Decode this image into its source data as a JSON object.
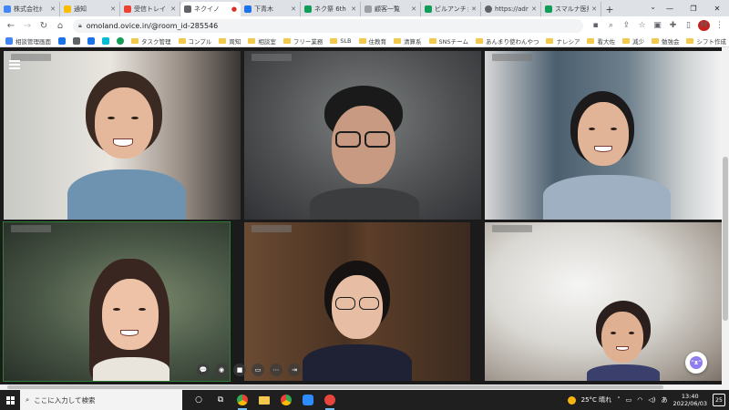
{
  "browser": {
    "tabs": [
      {
        "label": "株式会社ﾎ",
        "color": "#4285f4",
        "active": false
      },
      {
        "label": "通知",
        "color": "#fbbc04",
        "active": false
      },
      {
        "label": "受信トレイ",
        "color": "#ea4335",
        "active": false
      },
      {
        "label": "ネクイノ",
        "color": "#5f6368",
        "active": true
      },
      {
        "label": "下青木",
        "color": "#1a73e8",
        "active": false
      },
      {
        "label": "ネク祭 6th",
        "color": "#0f9d58",
        "active": false
      },
      {
        "label": "顧客一覧",
        "color": "#9aa0a6",
        "active": false
      },
      {
        "label": "ビルアンチョ",
        "color": "#0f9d58",
        "active": false
      },
      {
        "label": "https://adr",
        "color": "#5f6368",
        "active": false
      },
      {
        "label": "スマルナ医療",
        "color": "#0f9d58",
        "active": false
      }
    ],
    "new_tab": "+",
    "url": "omoland.ovice.in/@room_id-285546",
    "profile_initial": "M",
    "window_controls": {
      "minimize": "—",
      "restore": "❐",
      "close": "✕"
    }
  },
  "bookmarks": [
    {
      "label": "相談管理画面",
      "type": "ico",
      "color": "#4285f4"
    },
    {
      "label": "",
      "type": "ico",
      "color": "#1a73e8"
    },
    {
      "label": "",
      "type": "ico",
      "color": "#5f6368"
    },
    {
      "label": "",
      "type": "ico",
      "color": "#1a73e8"
    },
    {
      "label": "",
      "type": "ico",
      "color": "#00bcd4"
    },
    {
      "label": "",
      "type": "ico",
      "color": "#0f9d58"
    },
    {
      "label": "タスク管理",
      "type": "folder"
    },
    {
      "label": "コンプル",
      "type": "folder"
    },
    {
      "label": "周知",
      "type": "folder"
    },
    {
      "label": "相談室",
      "type": "folder"
    },
    {
      "label": "フリー業務",
      "type": "folder"
    },
    {
      "label": "SLB",
      "type": "folder"
    },
    {
      "label": "住教育",
      "type": "folder"
    },
    {
      "label": "清算系",
      "type": "folder"
    },
    {
      "label": "SNSチーム",
      "type": "folder"
    },
    {
      "label": "あんまり使わんやつ",
      "type": "folder"
    },
    {
      "label": "ナレシア",
      "type": "folder"
    },
    {
      "label": "看大佐",
      "type": "folder"
    },
    {
      "label": "減少",
      "type": "folder"
    },
    {
      "label": "勉強会",
      "type": "folder"
    },
    {
      "label": "シフト作成",
      "type": "folder"
    }
  ],
  "video": {
    "bot_label": "ᵔᴥᵔ",
    "controls": [
      {
        "name": "chat-icon",
        "glyph": "💬"
      },
      {
        "name": "broadcast-icon",
        "glyph": "◉"
      },
      {
        "name": "camera-icon",
        "glyph": "■"
      },
      {
        "name": "screen-share-icon",
        "glyph": "▭"
      },
      {
        "name": "more-icon",
        "glyph": "⋯"
      },
      {
        "name": "leave-icon",
        "glyph": "⇥"
      }
    ]
  },
  "taskbar": {
    "search_placeholder": "ここに入力して検索",
    "weather": "25°C 晴れ",
    "ime": "あ",
    "time": "13:40",
    "date": "2022/06/03",
    "notifications": "25"
  }
}
